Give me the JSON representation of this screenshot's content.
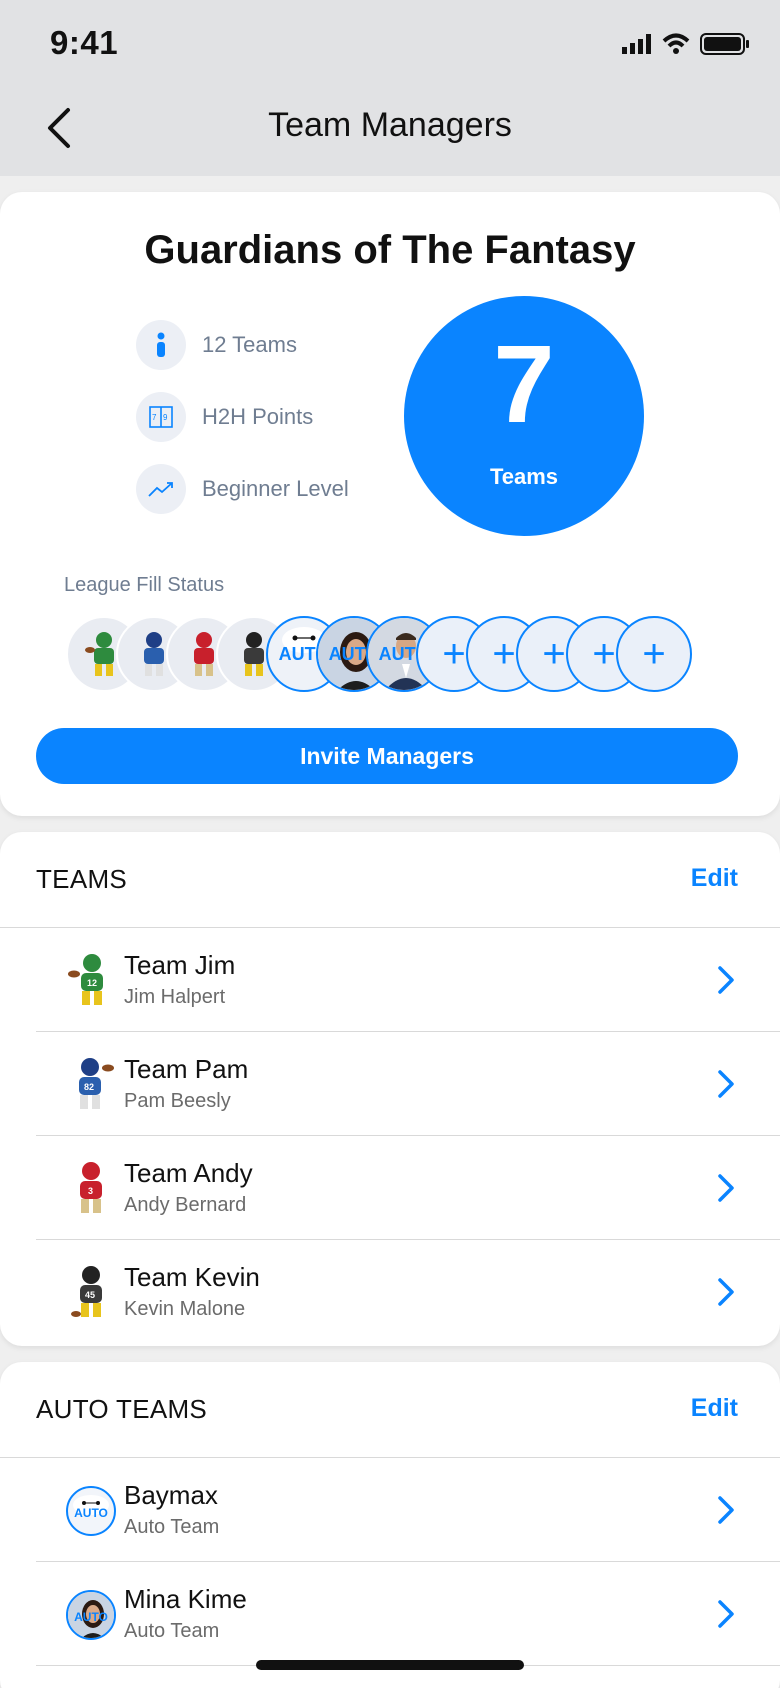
{
  "status_bar": {
    "time": "9:41"
  },
  "nav": {
    "title": "Team Managers"
  },
  "league": {
    "name": "Guardians of The Fantasy",
    "info": [
      {
        "icon": "person-icon",
        "label": "12 Teams"
      },
      {
        "icon": "scoring-icon",
        "label": "H2H Points"
      },
      {
        "icon": "trend-icon",
        "label": "Beginner Level"
      }
    ],
    "team_count": "7",
    "team_count_label": "Teams",
    "fill_status_label": "League Fill Status",
    "fill_slots": {
      "auto_label": "AUTO",
      "open_symbol": "+",
      "filled": 4,
      "auto": 3,
      "open": 5
    },
    "invite_button": "Invite Managers"
  },
  "teams_section": {
    "title": "TEAMS",
    "edit_label": "Edit",
    "rows": [
      {
        "title": "Team Jim",
        "subtitle": "Jim Halpert",
        "jersey": "12",
        "color": "#2e8b3e"
      },
      {
        "title": "Team Pam",
        "subtitle": "Pam Beesly",
        "jersey": "82",
        "color": "#2a5fae"
      },
      {
        "title": "Team Andy",
        "subtitle": "Andy Bernard",
        "jersey": "3",
        "color": "#c8202c"
      },
      {
        "title": "Team Kevin",
        "subtitle": "Kevin Malone",
        "jersey": "45",
        "color": "#3a3a3a"
      }
    ]
  },
  "auto_section": {
    "title": "AUTO TEAMS",
    "edit_label": "Edit",
    "auto_badge": "AUTO",
    "rows": [
      {
        "title": "Baymax",
        "subtitle": "Auto Team"
      },
      {
        "title": "Mina Kime",
        "subtitle": "Auto Team"
      }
    ]
  },
  "colors": {
    "accent": "#0a84ff",
    "header_bg": "#e1e2e4",
    "muted_text": "#6f7d91"
  }
}
